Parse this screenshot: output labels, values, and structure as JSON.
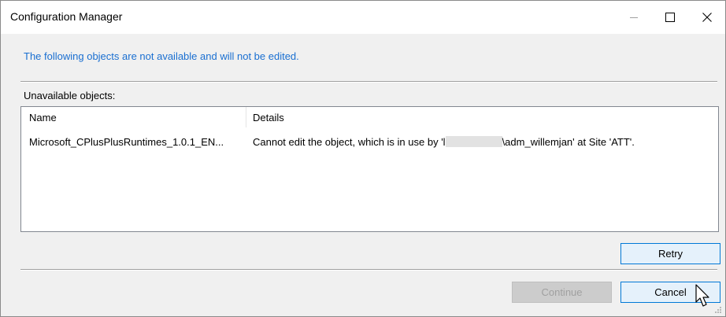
{
  "window": {
    "title": "Configuration Manager"
  },
  "info": {
    "message": "The following objects are not available and will not be edited."
  },
  "list": {
    "label": "Unavailable objects:",
    "columns": [
      "Name",
      "Details"
    ],
    "rows": [
      {
        "name": "Microsoft_CPlusPlusRuntimes_1.0.1_EN...",
        "details_prefix": "Cannot edit the object, which is in use by 'l",
        "details_suffix": "\\adm_willemjan' at Site 'ATT'."
      }
    ]
  },
  "buttons": {
    "retry": "Retry",
    "continue": "Continue",
    "cancel": "Cancel"
  },
  "colors": {
    "info_text": "#1a6fd1",
    "focus_border": "#0078d7"
  },
  "icons": {
    "minimize": "minimize-icon",
    "maximize": "maximize-icon",
    "close": "close-icon",
    "cursor": "mouse-pointer-icon",
    "grip": "resize-grip-icon"
  }
}
